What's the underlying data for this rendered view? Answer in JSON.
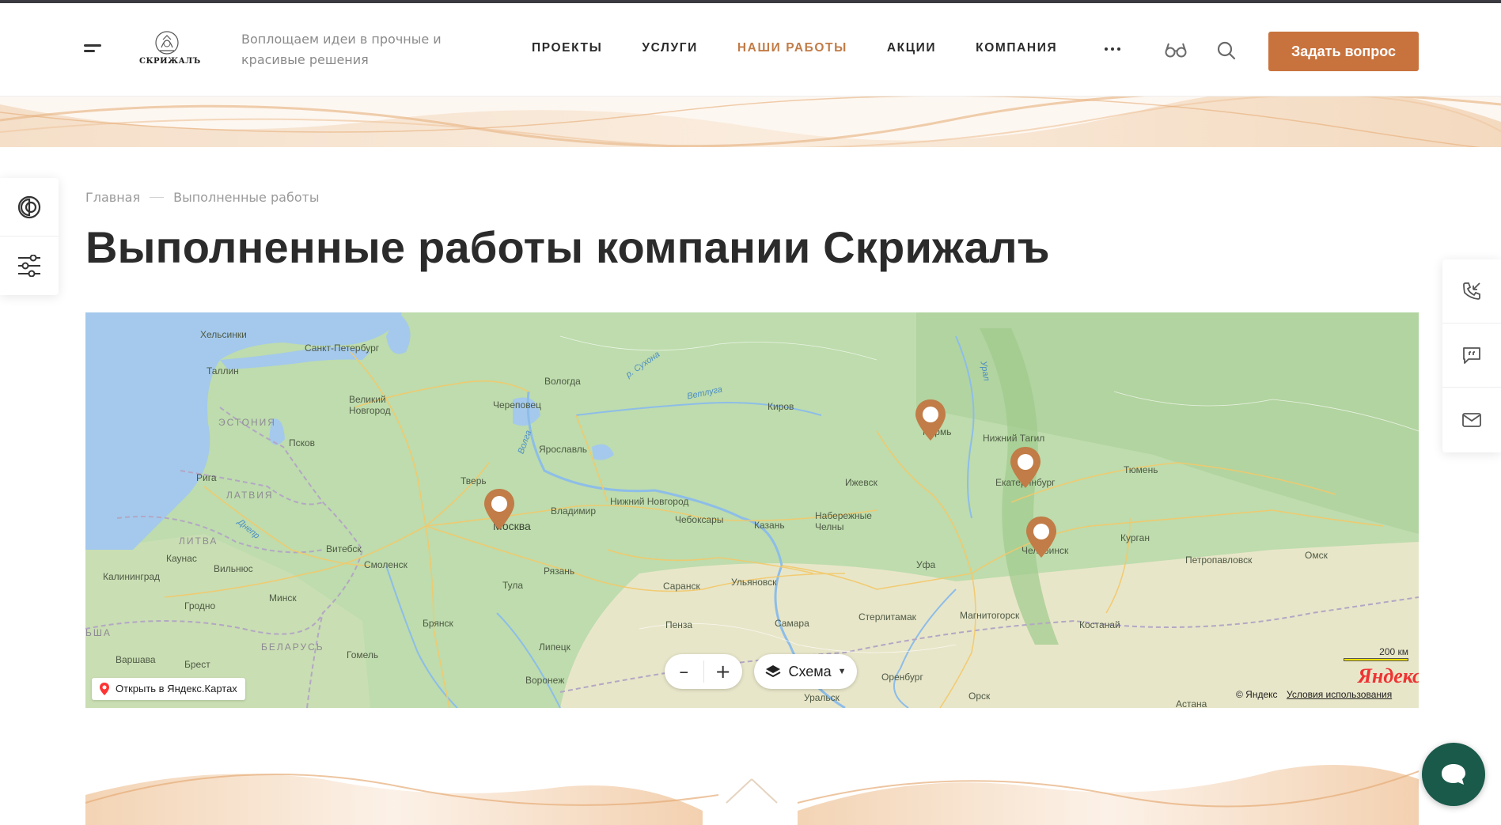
{
  "header": {
    "logo_text": "СКРИЖАЛЪ",
    "tagline": "Воплощаем идеи в прочные и красивые решения",
    "nav": [
      {
        "label": "ПРОЕКТЫ",
        "active": false
      },
      {
        "label": "УСЛУГИ",
        "active": false
      },
      {
        "label": "НАШИ РАБОТЫ",
        "active": true
      },
      {
        "label": "АКЦИИ",
        "active": false
      },
      {
        "label": "КОМПАНИЯ",
        "active": false
      }
    ],
    "ask_button": "Задать вопрос"
  },
  "breadcrumb": {
    "home": "Главная",
    "current": "Выполненные работы"
  },
  "page_title": "Выполненные работы компании Скрижалъ",
  "map": {
    "countries": [
      "ЭСТОНИЯ",
      "ЛАТВИЯ",
      "ЛИТВА",
      "БЕЛАРУСЬ",
      "ЬША"
    ],
    "cities": [
      "Хельсинки",
      "Санкт-Петербург",
      "Таллин",
      "Великий Новгород",
      "Псков",
      "Рига",
      "Каунас",
      "Вильнюс",
      "Калининград",
      "Гродно",
      "Минск",
      "Варшава",
      "Брест",
      "Витебск",
      "Смоленск",
      "Гомель",
      "Брянск",
      "Тверь",
      "Москва",
      "Тула",
      "Рязань",
      "Владимир",
      "Ярославль",
      "Вологда",
      "Череповец",
      "Нижний Новгород",
      "Чебоксары",
      "Казань",
      "Липецк",
      "Воронеж",
      "Пенза",
      "Саранск",
      "Ульяновск",
      "Самара",
      "Киров",
      "Ижевск",
      "Набережные Челны",
      "Уфа",
      "Стерлитамак",
      "Магнитогорск",
      "Оренбург",
      "Уральск",
      "Орск",
      "Нижний Тагил",
      "Пермь",
      "Екатеринбург",
      "Челябинск",
      "Тюмень",
      "Курган",
      "Петропавловск",
      "Омск",
      "Костанай",
      "Астана"
    ],
    "rivers": [
      "р. Сухона",
      "Ветлуга",
      "Волга",
      "Днепр",
      "Урал"
    ],
    "open_link": "Открыть в Яндекс.Картах",
    "layers_label": "Схема",
    "zoom_out": "–",
    "zoom_in": "+",
    "scale_label": "200 км",
    "logo": "Яндекс",
    "copyright": "© Яндекс",
    "terms": "Условия использования"
  },
  "colors": {
    "accent": "#c8733e",
    "nav_active": "#c17c47",
    "chat": "#1a5a4b",
    "map_land": "#bedcad",
    "map_water": "#a4c9ec",
    "pin": "#c17c47"
  },
  "icons": [
    "menu-icon",
    "glasses-icon",
    "search-icon",
    "contrast-icon",
    "filter-icon",
    "phone-callback-icon",
    "chat-quote-icon",
    "mail-icon",
    "chat-icon",
    "layers-icon",
    "map-pin-icon"
  ]
}
